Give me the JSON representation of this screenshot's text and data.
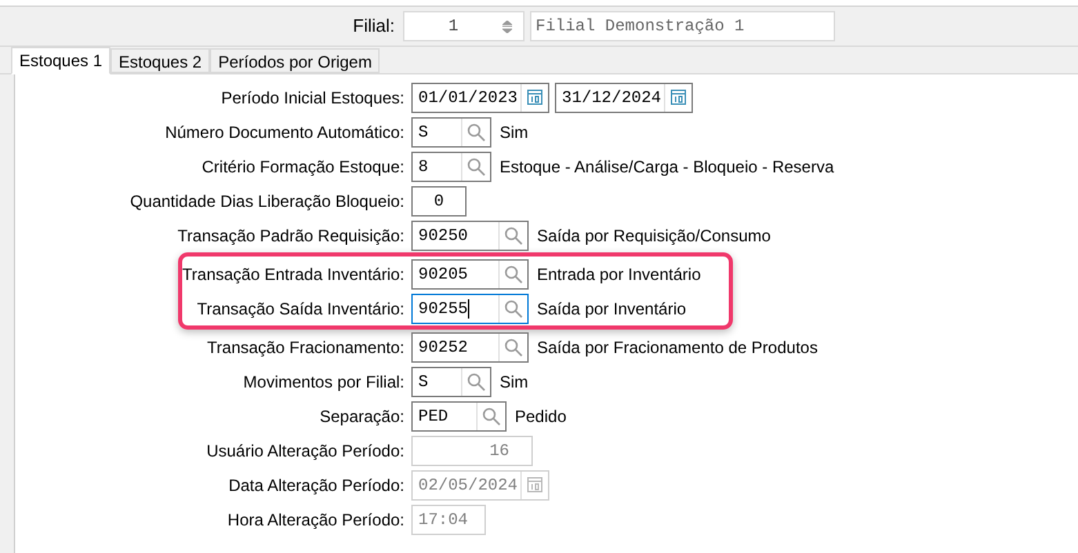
{
  "header": {
    "label": "Filial:",
    "value": "1",
    "description": "Filial Demonstração 1"
  },
  "tabs": [
    {
      "label": "Estoques 1",
      "selected": true
    },
    {
      "label": "Estoques 2",
      "selected": false
    },
    {
      "label": "Períodos por Origem",
      "selected": false
    }
  ],
  "sections": [
    {
      "highlighted": false,
      "rows": [
        {
          "kind": "date_range",
          "label": "Período Inicial Estoques:",
          "value": "01/01/2023",
          "value2": "31/12/2024",
          "disabled": false,
          "focused": false
        },
        {
          "kind": "lookup",
          "label": "Número Documento Automático:",
          "value": "S",
          "description": "Sim",
          "disabled": false,
          "focused": false
        },
        {
          "kind": "lookup",
          "label": "Critério Formação Estoque:",
          "value": "8",
          "description": "Estoque - Análise/Carga - Bloqueio - Reserva",
          "disabled": false,
          "focused": false
        },
        {
          "kind": "number",
          "label": "Quantidade Dias Liberação Bloqueio:",
          "value": "0",
          "disabled": false,
          "focused": false
        },
        {
          "kind": "lookup",
          "label": "Transação Padrão Requisição:",
          "value": "90250",
          "description": "Saída por Requisição/Consumo",
          "disabled": false,
          "focused": false
        }
      ]
    },
    {
      "highlighted": true,
      "rows": [
        {
          "kind": "lookup",
          "label": "Transação Entrada Inventário:",
          "value": "90205",
          "description": "Entrada por Inventário",
          "disabled": false,
          "focused": false
        },
        {
          "kind": "lookup",
          "label": "Transação Saída Inventário:",
          "value": "90255",
          "description": "Saída por Inventário",
          "disabled": false,
          "focused": true
        }
      ]
    },
    {
      "highlighted": false,
      "rows": [
        {
          "kind": "lookup",
          "label": "Transação Fracionamento:",
          "value": "90252",
          "description": "Saída por Fracionamento de Produtos",
          "disabled": false,
          "focused": false
        },
        {
          "kind": "lookup",
          "label": "Movimentos por Filial:",
          "value": "S",
          "description": "Sim",
          "disabled": false,
          "focused": false
        },
        {
          "kind": "lookup",
          "label": "Separação:",
          "value": "PED",
          "description": "Pedido",
          "disabled": false,
          "focused": false
        },
        {
          "kind": "number",
          "label": "Usuário Alteração Período:",
          "value": "16",
          "disabled": true,
          "focused": false
        },
        {
          "kind": "date",
          "label": "Data Alteração Período:",
          "value": "02/05/2024",
          "disabled": true,
          "focused": false
        },
        {
          "kind": "text",
          "label": "Hora Alteração Período:",
          "value": "17:04",
          "disabled": true,
          "focused": false
        }
      ]
    }
  ]
}
